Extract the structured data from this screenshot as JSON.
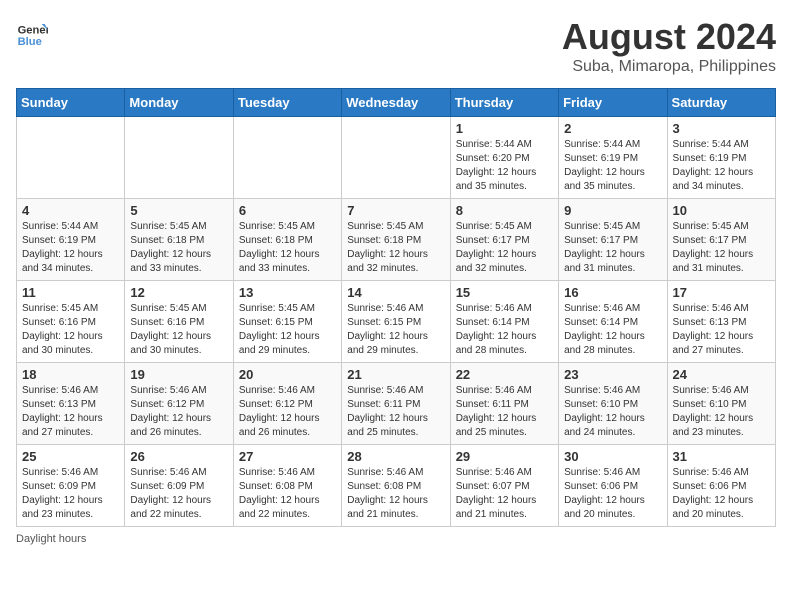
{
  "header": {
    "logo_general": "General",
    "logo_blue": "Blue",
    "month_year": "August 2024",
    "location": "Suba, Mimaropa, Philippines"
  },
  "days_of_week": [
    "Sunday",
    "Monday",
    "Tuesday",
    "Wednesday",
    "Thursday",
    "Friday",
    "Saturday"
  ],
  "weeks": [
    [
      {
        "day": "",
        "info": ""
      },
      {
        "day": "",
        "info": ""
      },
      {
        "day": "",
        "info": ""
      },
      {
        "day": "",
        "info": ""
      },
      {
        "day": "1",
        "info": "Sunrise: 5:44 AM\nSunset: 6:20 PM\nDaylight: 12 hours\nand 35 minutes."
      },
      {
        "day": "2",
        "info": "Sunrise: 5:44 AM\nSunset: 6:19 PM\nDaylight: 12 hours\nand 35 minutes."
      },
      {
        "day": "3",
        "info": "Sunrise: 5:44 AM\nSunset: 6:19 PM\nDaylight: 12 hours\nand 34 minutes."
      }
    ],
    [
      {
        "day": "4",
        "info": "Sunrise: 5:44 AM\nSunset: 6:19 PM\nDaylight: 12 hours\nand 34 minutes."
      },
      {
        "day": "5",
        "info": "Sunrise: 5:45 AM\nSunset: 6:18 PM\nDaylight: 12 hours\nand 33 minutes."
      },
      {
        "day": "6",
        "info": "Sunrise: 5:45 AM\nSunset: 6:18 PM\nDaylight: 12 hours\nand 33 minutes."
      },
      {
        "day": "7",
        "info": "Sunrise: 5:45 AM\nSunset: 6:18 PM\nDaylight: 12 hours\nand 32 minutes."
      },
      {
        "day": "8",
        "info": "Sunrise: 5:45 AM\nSunset: 6:17 PM\nDaylight: 12 hours\nand 32 minutes."
      },
      {
        "day": "9",
        "info": "Sunrise: 5:45 AM\nSunset: 6:17 PM\nDaylight: 12 hours\nand 31 minutes."
      },
      {
        "day": "10",
        "info": "Sunrise: 5:45 AM\nSunset: 6:17 PM\nDaylight: 12 hours\nand 31 minutes."
      }
    ],
    [
      {
        "day": "11",
        "info": "Sunrise: 5:45 AM\nSunset: 6:16 PM\nDaylight: 12 hours\nand 30 minutes."
      },
      {
        "day": "12",
        "info": "Sunrise: 5:45 AM\nSunset: 6:16 PM\nDaylight: 12 hours\nand 30 minutes."
      },
      {
        "day": "13",
        "info": "Sunrise: 5:45 AM\nSunset: 6:15 PM\nDaylight: 12 hours\nand 29 minutes."
      },
      {
        "day": "14",
        "info": "Sunrise: 5:46 AM\nSunset: 6:15 PM\nDaylight: 12 hours\nand 29 minutes."
      },
      {
        "day": "15",
        "info": "Sunrise: 5:46 AM\nSunset: 6:14 PM\nDaylight: 12 hours\nand 28 minutes."
      },
      {
        "day": "16",
        "info": "Sunrise: 5:46 AM\nSunset: 6:14 PM\nDaylight: 12 hours\nand 28 minutes."
      },
      {
        "day": "17",
        "info": "Sunrise: 5:46 AM\nSunset: 6:13 PM\nDaylight: 12 hours\nand 27 minutes."
      }
    ],
    [
      {
        "day": "18",
        "info": "Sunrise: 5:46 AM\nSunset: 6:13 PM\nDaylight: 12 hours\nand 27 minutes."
      },
      {
        "day": "19",
        "info": "Sunrise: 5:46 AM\nSunset: 6:12 PM\nDaylight: 12 hours\nand 26 minutes."
      },
      {
        "day": "20",
        "info": "Sunrise: 5:46 AM\nSunset: 6:12 PM\nDaylight: 12 hours\nand 26 minutes."
      },
      {
        "day": "21",
        "info": "Sunrise: 5:46 AM\nSunset: 6:11 PM\nDaylight: 12 hours\nand 25 minutes."
      },
      {
        "day": "22",
        "info": "Sunrise: 5:46 AM\nSunset: 6:11 PM\nDaylight: 12 hours\nand 25 minutes."
      },
      {
        "day": "23",
        "info": "Sunrise: 5:46 AM\nSunset: 6:10 PM\nDaylight: 12 hours\nand 24 minutes."
      },
      {
        "day": "24",
        "info": "Sunrise: 5:46 AM\nSunset: 6:10 PM\nDaylight: 12 hours\nand 23 minutes."
      }
    ],
    [
      {
        "day": "25",
        "info": "Sunrise: 5:46 AM\nSunset: 6:09 PM\nDaylight: 12 hours\nand 23 minutes."
      },
      {
        "day": "26",
        "info": "Sunrise: 5:46 AM\nSunset: 6:09 PM\nDaylight: 12 hours\nand 22 minutes."
      },
      {
        "day": "27",
        "info": "Sunrise: 5:46 AM\nSunset: 6:08 PM\nDaylight: 12 hours\nand 22 minutes."
      },
      {
        "day": "28",
        "info": "Sunrise: 5:46 AM\nSunset: 6:08 PM\nDaylight: 12 hours\nand 21 minutes."
      },
      {
        "day": "29",
        "info": "Sunrise: 5:46 AM\nSunset: 6:07 PM\nDaylight: 12 hours\nand 21 minutes."
      },
      {
        "day": "30",
        "info": "Sunrise: 5:46 AM\nSunset: 6:06 PM\nDaylight: 12 hours\nand 20 minutes."
      },
      {
        "day": "31",
        "info": "Sunrise: 5:46 AM\nSunset: 6:06 PM\nDaylight: 12 hours\nand 20 minutes."
      }
    ]
  ],
  "footer": {
    "note": "Daylight hours"
  }
}
